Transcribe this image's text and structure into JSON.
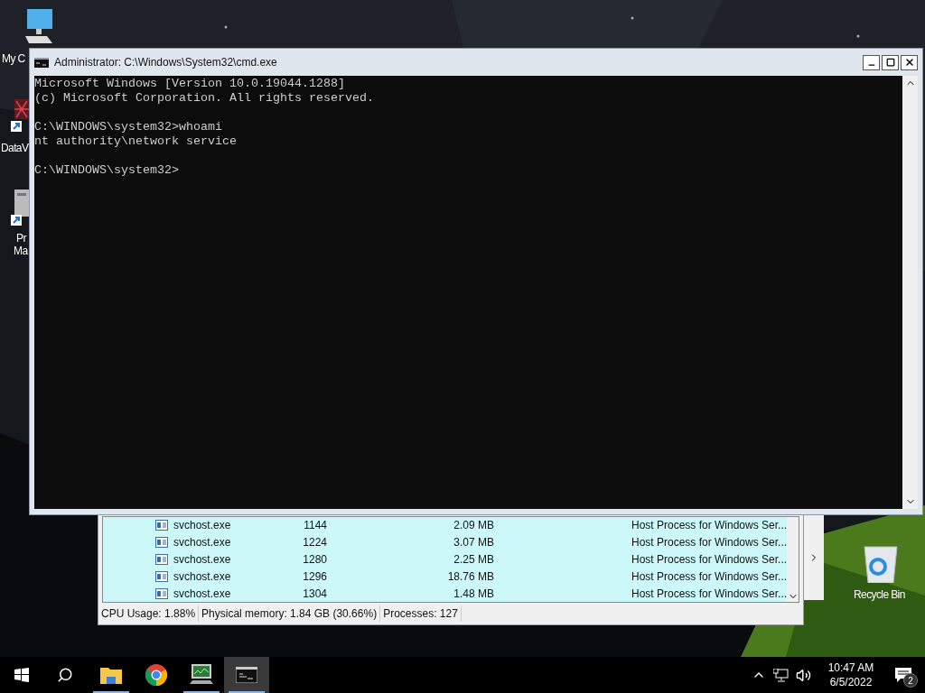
{
  "desktop_icons": [
    {
      "kind": "computer",
      "label_lines": [
        "My C"
      ]
    },
    {
      "kind": "network-app",
      "label_lines": [
        "DataV"
      ]
    },
    {
      "kind": "server-app",
      "label_lines": [
        "Pr",
        "Ma"
      ]
    },
    {
      "kind": "recycle",
      "label_lines": [
        "Recycle Bin"
      ]
    }
  ],
  "task_manager": {
    "rows": [
      {
        "name": "svchost.exe",
        "pid": "1144",
        "memory": "2.09 MB",
        "description": "Host Process for Windows Ser..."
      },
      {
        "name": "svchost.exe",
        "pid": "1224",
        "memory": "3.07 MB",
        "description": "Host Process for Windows Ser..."
      },
      {
        "name": "svchost.exe",
        "pid": "1280",
        "memory": "2.25 MB",
        "description": "Host Process for Windows Ser..."
      },
      {
        "name": "svchost.exe",
        "pid": "1296",
        "memory": "18.76 MB",
        "description": "Host Process for Windows Ser..."
      },
      {
        "name": "svchost.exe",
        "pid": "1304",
        "memory": "1.48 MB",
        "description": "Host Process for Windows Ser..."
      }
    ],
    "status_bar": [
      "CPU Usage: 1.88%",
      "Physical memory: 1.84 GB (30.66%)",
      "Processes: 127"
    ]
  },
  "cmd_window": {
    "title": "Administrator: C:\\Windows\\System32\\cmd.exe",
    "blocks": [
      [
        "Microsoft Windows [Version 10.0.19044.1288]",
        "(c) Microsoft Corporation. All rights reserved."
      ],
      [
        "C:\\WINDOWS\\system32>whoami",
        "nt authority\\network service"
      ],
      [
        "C:\\WINDOWS\\system32>"
      ]
    ]
  },
  "taskbar": {
    "apps": [
      {
        "kind": "folder",
        "selected": false,
        "running": true
      },
      {
        "kind": "chrome",
        "selected": false,
        "running": false
      },
      {
        "kind": "monitor",
        "selected": false,
        "running": true
      },
      {
        "kind": "console",
        "selected": true,
        "running": true
      }
    ],
    "tray": {
      "time": "10:47 AM",
      "date": "6/5/2022",
      "notifications": "2"
    }
  }
}
